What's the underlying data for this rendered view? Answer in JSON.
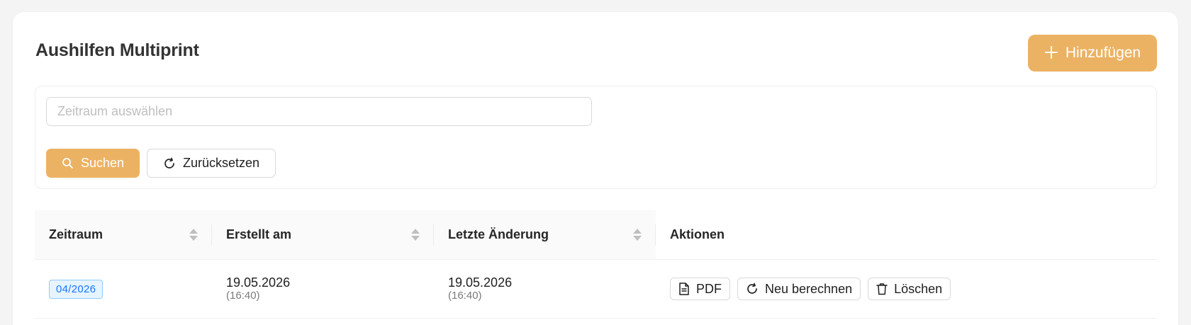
{
  "page": {
    "title": "Aushilfen Multiprint",
    "add_label": "Hinzufügen"
  },
  "filter": {
    "period_placeholder": "Zeitraum auswählen",
    "search_label": "Suchen",
    "reset_label": "Zurücksetzen"
  },
  "table": {
    "columns": [
      "Zeitraum",
      "Erstellt am",
      "Letzte Änderung",
      "Aktionen"
    ],
    "rows": [
      {
        "period": "04/2026",
        "created_date": "19.05.2026",
        "created_time": "(16:40)",
        "modified_date": "19.05.2026",
        "modified_time": "(16:40)",
        "actions": [
          "PDF",
          "Neu berechnen",
          "Löschen"
        ]
      }
    ]
  },
  "colors": {
    "primary": "#ecb263",
    "tag_text": "#1677ff",
    "tag_bg": "#e6f4ff"
  },
  "icons": [
    "plus-icon",
    "search-icon",
    "reload-icon",
    "file-pdf-icon",
    "trash-icon",
    "sort-icon"
  ]
}
